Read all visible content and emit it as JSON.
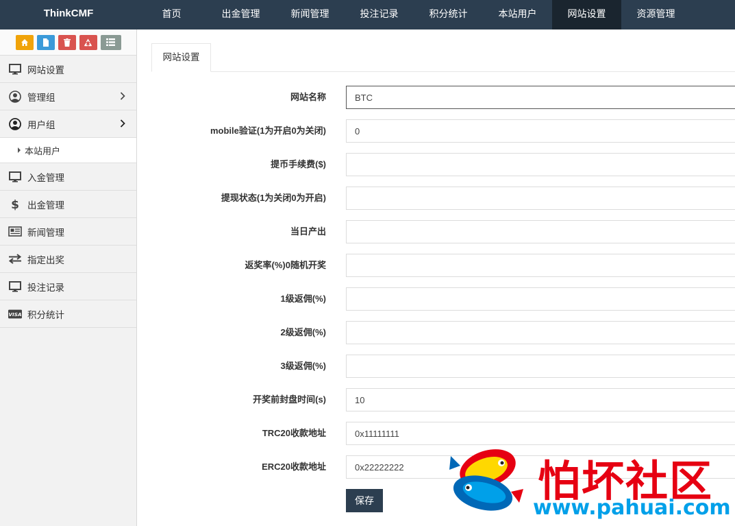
{
  "brand": "ThinkCMF",
  "nav": [
    {
      "label": "首页"
    },
    {
      "label": "出金管理"
    },
    {
      "label": "新闻管理"
    },
    {
      "label": "投注记录"
    },
    {
      "label": "积分统计"
    },
    {
      "label": "本站用户"
    },
    {
      "label": "网站设置",
      "active": true
    },
    {
      "label": "资源管理"
    }
  ],
  "shortcuts": [
    {
      "icon": "home-icon",
      "color": "#f0a30a"
    },
    {
      "icon": "file-icon",
      "color": "#3a9ad9"
    },
    {
      "icon": "trash-icon",
      "color": "#d9534f"
    },
    {
      "icon": "recycle-icon",
      "color": "#d9534f"
    },
    {
      "icon": "list-icon",
      "color": "#8a9a94"
    }
  ],
  "sidebar": {
    "items": [
      {
        "label": "网站设置",
        "icon": "monitor-icon"
      },
      {
        "label": "管理组",
        "icon": "user-circle-icon",
        "has_children": true
      },
      {
        "label": "用户组",
        "icon": "user-circle-icon",
        "has_children": true,
        "open": true
      },
      {
        "label": "本站用户",
        "sub": true
      },
      {
        "label": "入金管理",
        "icon": "monitor-icon"
      },
      {
        "label": "出金管理",
        "icon": "dollar-icon"
      },
      {
        "label": "新闻管理",
        "icon": "newspaper-icon"
      },
      {
        "label": "指定出奖",
        "icon": "exchange-icon"
      },
      {
        "label": "投注记录",
        "icon": "monitor-icon"
      },
      {
        "label": "积分统计",
        "icon": "visa-icon"
      }
    ]
  },
  "tab": {
    "label": "网站设置"
  },
  "form": {
    "fields": [
      {
        "label": "网站名称",
        "value": "BTC"
      },
      {
        "label": "mobile验证(1为开启0为关闭)",
        "value": "0"
      },
      {
        "label": "提币手续费($)",
        "value": ""
      },
      {
        "label": "提现状态(1为关闭0为开启)",
        "value": ""
      },
      {
        "label": "当日产出",
        "value": ""
      },
      {
        "label": "返奖率(%)0随机开奖",
        "value": ""
      },
      {
        "label": "1级返佣(%)",
        "value": ""
      },
      {
        "label": "2级返佣(%)",
        "value": ""
      },
      {
        "label": "3级返佣(%)",
        "value": ""
      },
      {
        "label": "开奖前封盘时间(s)",
        "value": "10"
      },
      {
        "label": "TRC20收款地址",
        "value": "0x11111111"
      },
      {
        "label": "ERC20收款地址",
        "value": "0x22222222"
      }
    ],
    "save_label": "保存"
  },
  "watermark": {
    "text": "怕坏社区",
    "url": "www.pahuai.com"
  }
}
